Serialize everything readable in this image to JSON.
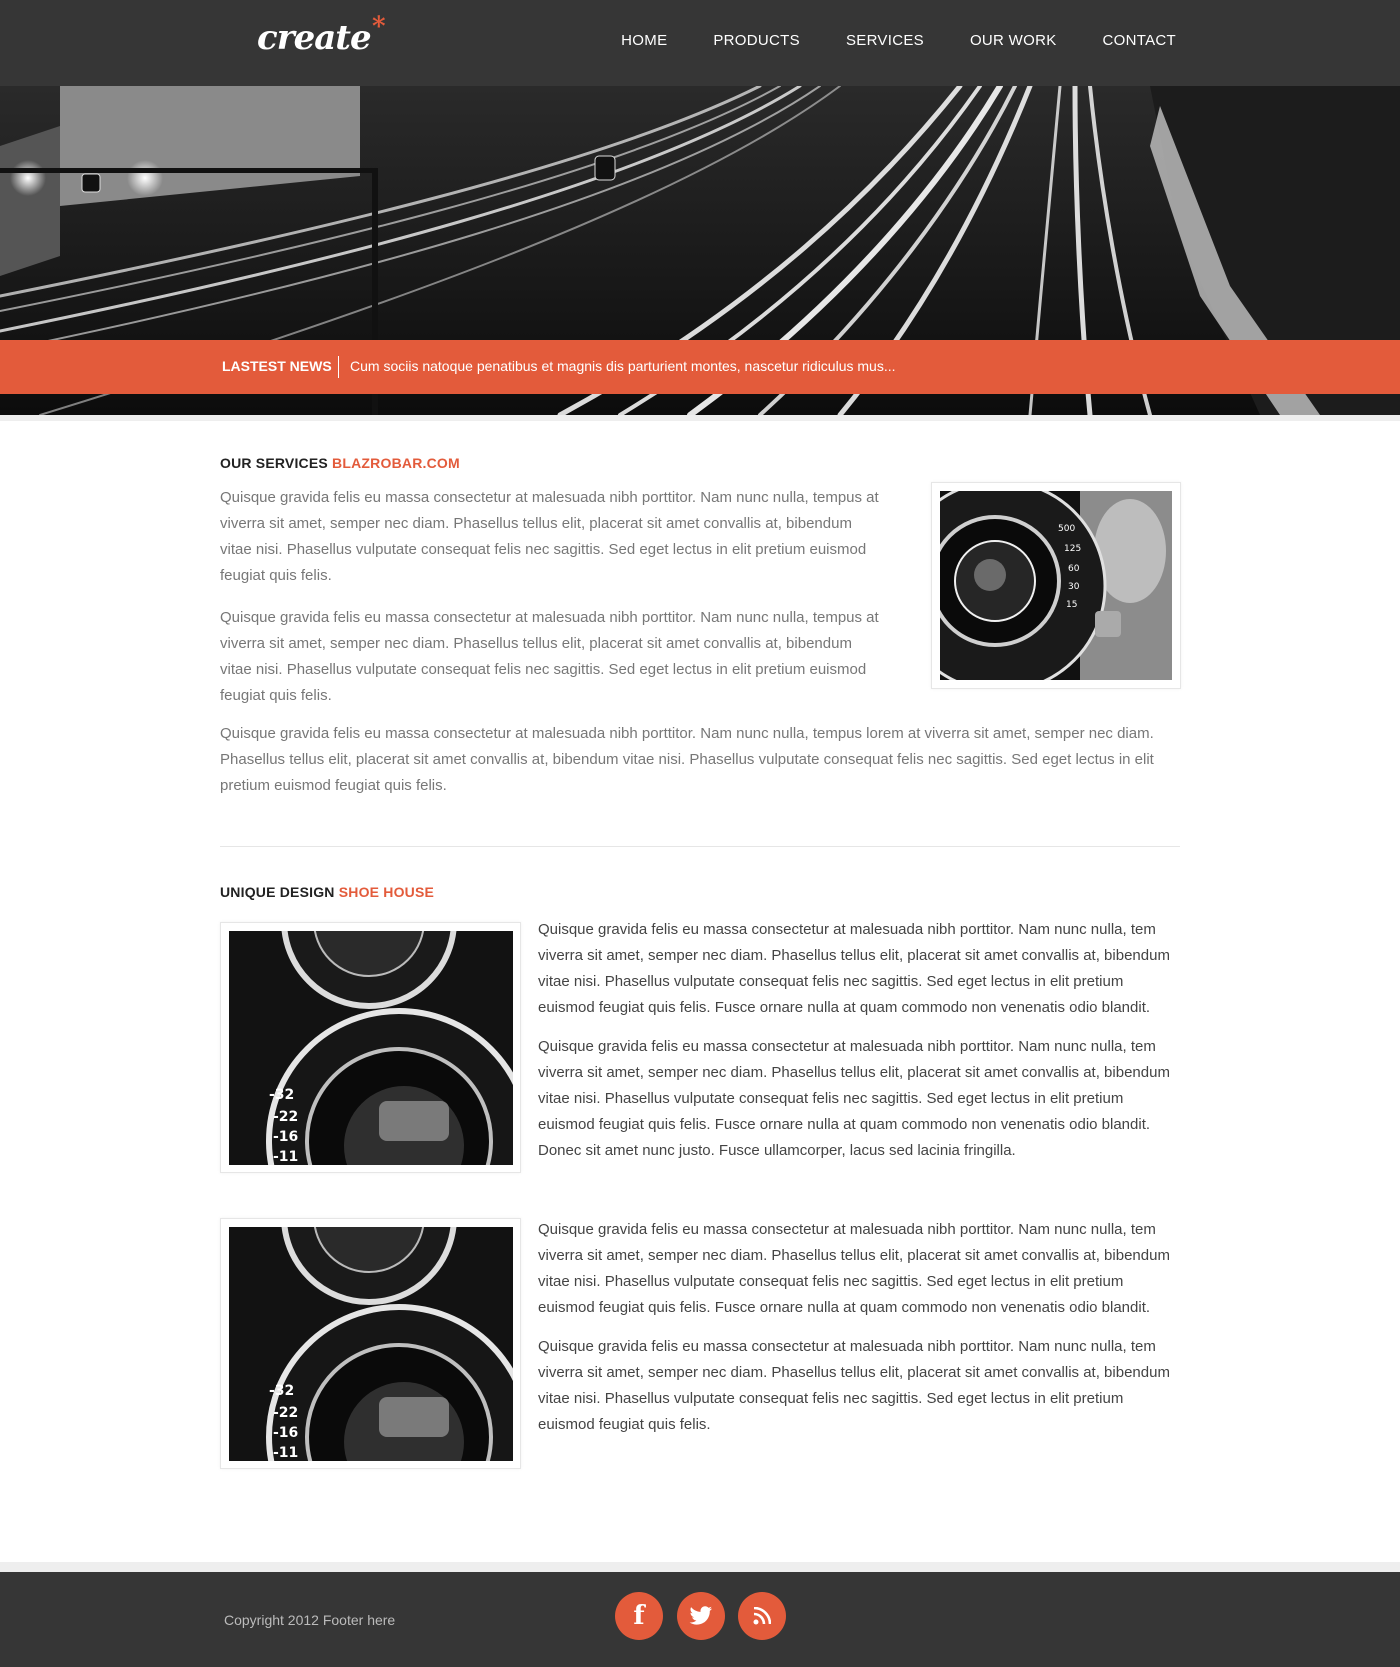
{
  "header": {
    "logo_text": "create",
    "logo_mark": "*",
    "nav": [
      {
        "label": "HOME"
      },
      {
        "label": "PRODUCTS"
      },
      {
        "label": "SERVICES"
      },
      {
        "label": "OUR WORK"
      },
      {
        "label": "CONTACT"
      }
    ]
  },
  "hero": {
    "image": "highway-light-trails-photo",
    "news_label": "LASTEST NEWS",
    "news_text": "Cum sociis natoque penatibus et magnis dis parturient montes, nascetur ridiculus mus..."
  },
  "services": {
    "title": "OUR SERVICES",
    "title_accent": "BLAZROBAR.COM",
    "paragraphs": [
      "Quisque gravida felis eu massa consectetur at malesuada nibh porttitor. Nam nunc nulla, tempus at viverra sit amet, semper nec diam. Phasellus tellus elit, placerat sit amet convallis at, bibendum vitae nisi. Phasellus vulputate consequat felis nec sagittis. Sed eget lectus in elit pretium euismod feugiat quis felis.",
      "Quisque gravida felis eu massa consectetur at malesuada nibh porttitor. Nam nunc nulla, tempus at viverra sit amet, semper nec diam. Phasellus tellus elit, placerat sit amet convallis at, bibendum vitae nisi. Phasellus vulputate consequat felis nec sagittis. Sed eget lectus in elit pretium euismod feugiat quis felis.",
      "Quisque gravida felis eu massa consectetur at malesuada nibh porttitor. Nam nunc nulla, tempus lorem at  viverra sit amet, semper nec diam. Phasellus tellus elit, placerat sit amet convallis at, bibendum vitae nisi. Phasellus vulputate consequat felis nec sagittis. Sed eget lectus in elit pretium euismod feugiat quis felis."
    ],
    "image": "camera-lens-photo"
  },
  "design": {
    "title": "UNIQUE DESIGN",
    "title_accent": "SHOE HOUSE",
    "rows": [
      {
        "image": "camera-dial-photo",
        "paragraphs": [
          "Quisque gravida felis eu massa consectetur at malesuada nibh porttitor. Nam nunc nulla, tem viverra sit amet, semper nec diam. Phasellus tellus elit, placerat sit amet convallis at, bibendum vitae nisi.  Phasellus vulputate consequat felis nec sagittis. Sed eget lectus in elit pretium euismod feugiat quis felis. Fusce ornare nulla at quam commodo non venenatis odio blandit.",
          "Quisque gravida felis eu massa consectetur at malesuada nibh porttitor. Nam nunc nulla, tem viverra sit amet, semper nec diam. Phasellus tellus elit, placerat sit amet convallis at, bibendum vitae nisi. Phasellus vulputate consequat felis nec sagittis. Sed eget lectus in elit pretium euismod feugiat quis felis. Fusce ornare nulla at quam commodo non venenatis odio blandit. Donec sit amet nunc justo. Fusce ullamcorper, lacus sed lacinia fringilla."
        ]
      },
      {
        "image": "camera-dial-photo",
        "paragraphs": [
          "Quisque gravida felis eu massa consectetur at malesuada nibh porttitor. Nam nunc nulla, tem viverra sit amet, semper nec diam. Phasellus tellus elit, placerat sit amet convallis at, bibendum vitae nisi.  Phasellus vulputate consequat felis nec sagittis. Sed eget lectus in elit pretium euismod feugiat quis felis. Fusce ornare nulla at quam commodo non venenatis odio blandit.",
          "Quisque gravida felis eu massa consectetur at malesuada nibh porttitor. Nam nunc nulla, tem viverra sit amet, semper nec diam. Phasellus tellus elit, placerat sit amet convallis at, bibendum vitae nisi. Phasellus vulputate consequat felis nec sagittis. Sed eget lectus in elit pretium euismod feugiat quis felis."
        ]
      }
    ]
  },
  "footer": {
    "copyright": "Copyright 2012 Footer here",
    "social": [
      {
        "icon": "facebook-icon",
        "glyph": "f"
      },
      {
        "icon": "twitter-icon",
        "glyph": "t"
      },
      {
        "icon": "rss-icon",
        "glyph": "rss"
      }
    ]
  },
  "colors": {
    "accent": "#e35b3b",
    "header_bg": "#363636",
    "text_muted": "#777777"
  }
}
